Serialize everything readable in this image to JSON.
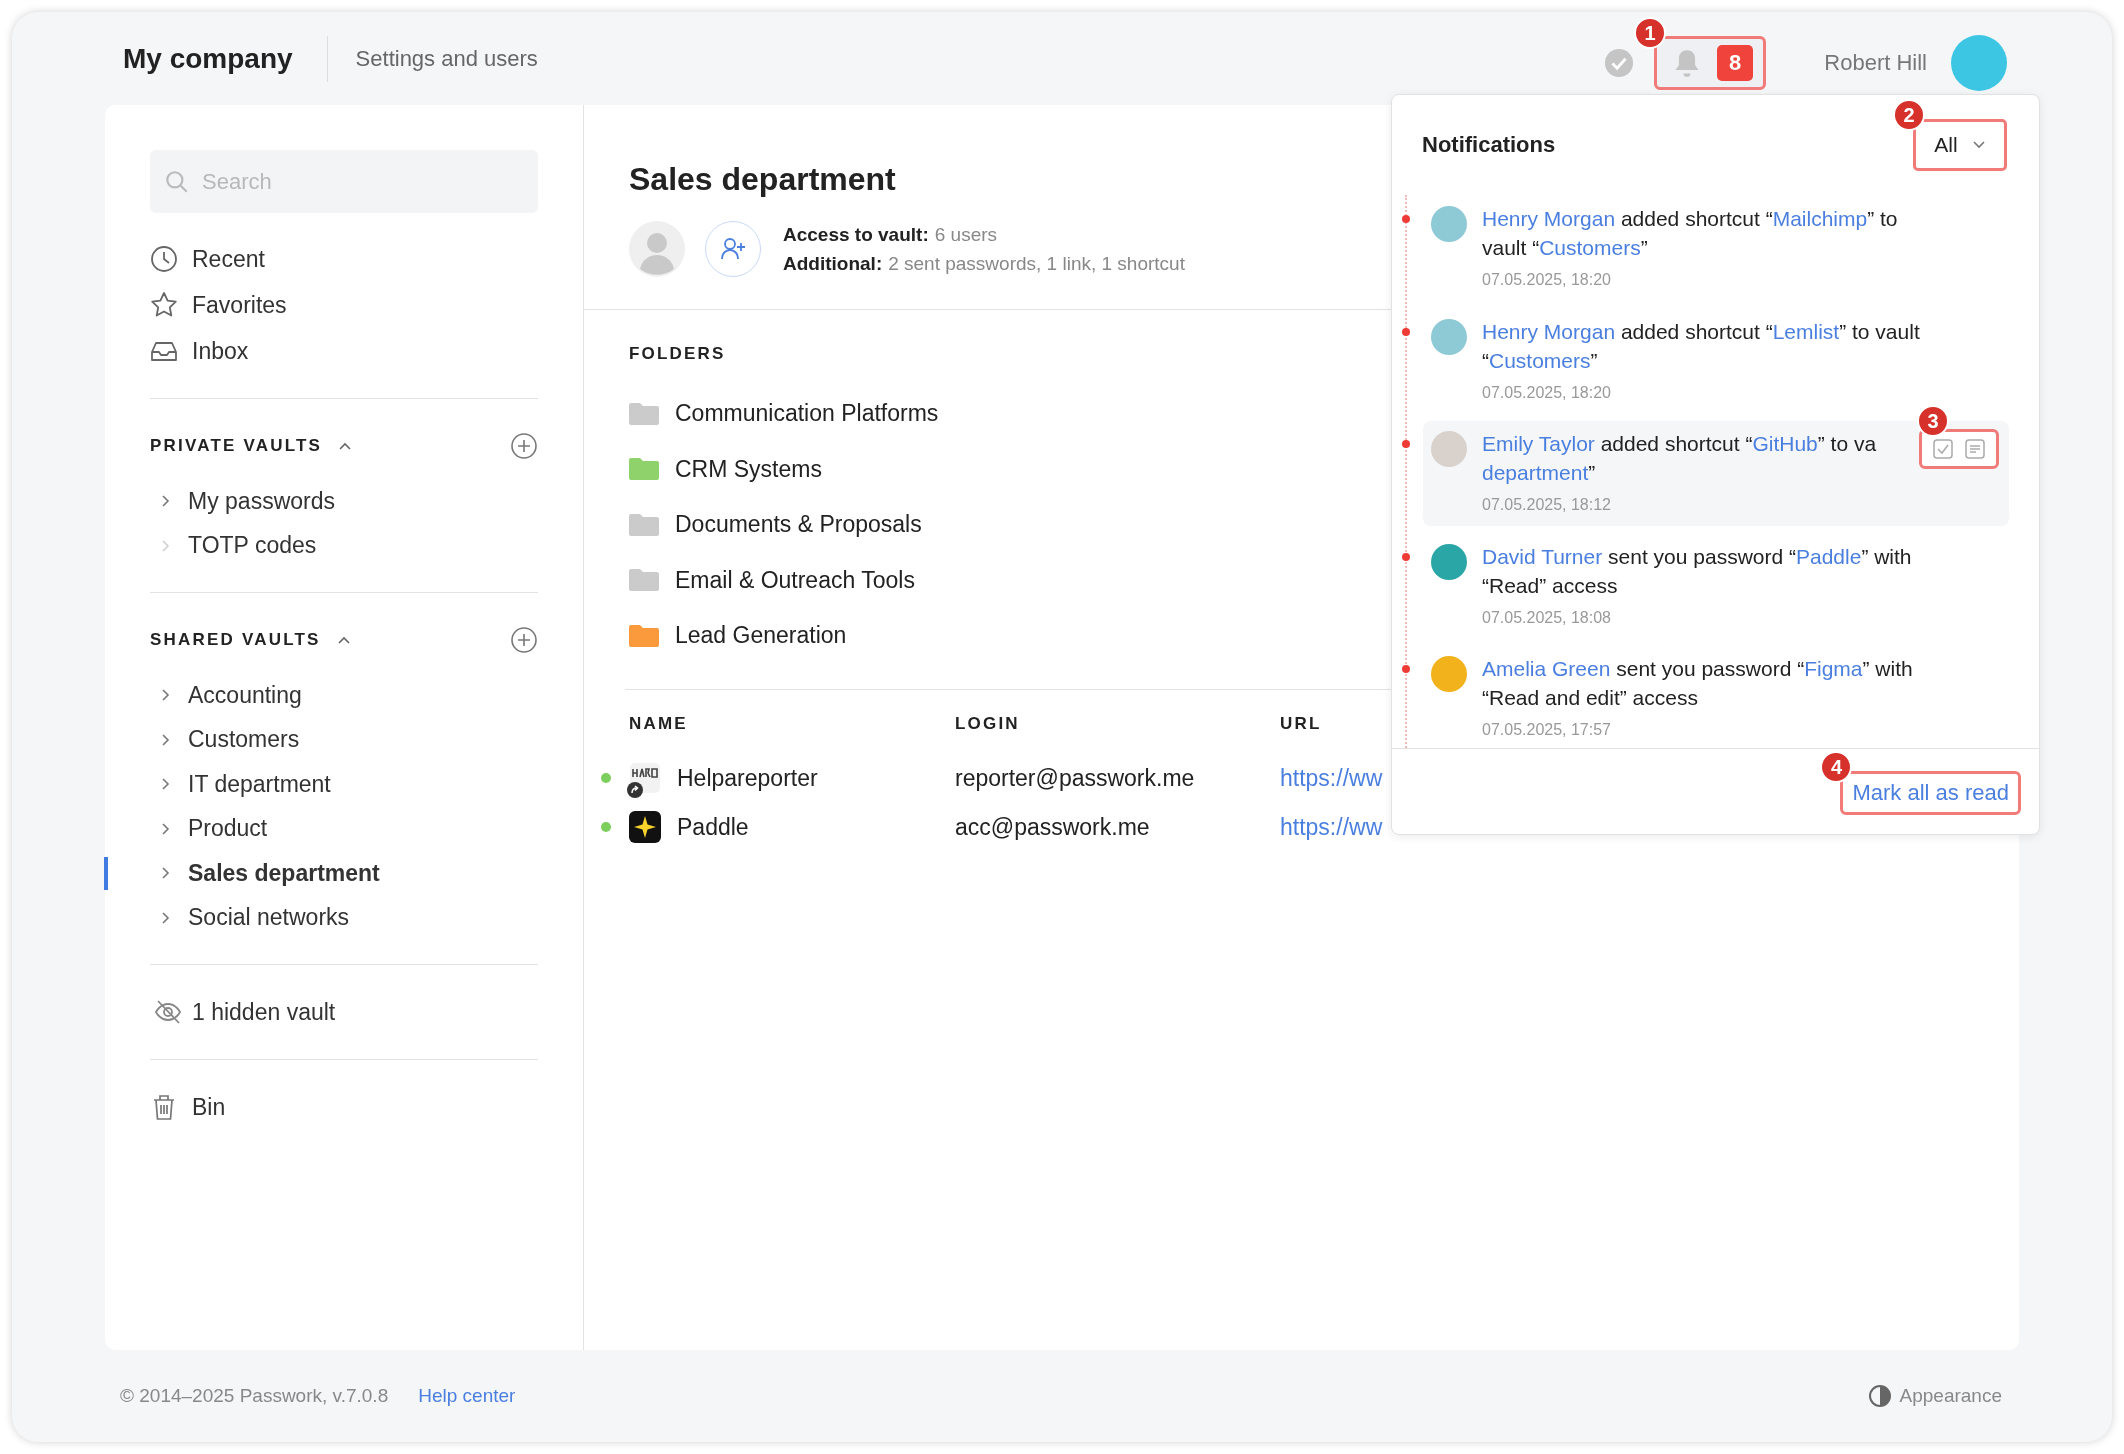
{
  "header": {
    "company": "My company",
    "section": "Settings and users",
    "notification_count": "8",
    "notification_callout": "1",
    "user_name": "Robert Hill"
  },
  "sidebar": {
    "search_placeholder": "Search",
    "nav": [
      {
        "label": "Recent"
      },
      {
        "label": "Favorites"
      },
      {
        "label": "Inbox"
      }
    ],
    "sections": [
      {
        "title": "PRIVATE VAULTS",
        "expanded": true,
        "items": [
          {
            "label": "My passwords",
            "has_children": true,
            "selected": false
          },
          {
            "label": "TOTP codes",
            "has_children": false,
            "selected": false
          }
        ]
      },
      {
        "title": "SHARED VAULTS",
        "expanded": true,
        "items": [
          {
            "label": "Accounting",
            "has_children": true,
            "selected": false
          },
          {
            "label": "Customers",
            "has_children": true,
            "selected": false
          },
          {
            "label": "IT department",
            "has_children": true,
            "selected": false
          },
          {
            "label": "Product",
            "has_children": true,
            "selected": false
          },
          {
            "label": "Sales department",
            "has_children": true,
            "selected": true
          },
          {
            "label": "Social networks",
            "has_children": true,
            "selected": false
          }
        ]
      }
    ],
    "hidden": "1 hidden vault",
    "bin": "Bin"
  },
  "vault": {
    "title": "Sales department",
    "info": [
      {
        "label": "Access to vault:",
        "value": "6 users"
      },
      {
        "label": "Additional:",
        "value": "2 sent passwords, 1 link, 1 shortcut"
      }
    ]
  },
  "folders": {
    "heading": "FOLDERS",
    "items": [
      {
        "name": "Communication Platforms",
        "color": "#cbcbcb"
      },
      {
        "name": "CRM Systems",
        "color": "#8fd16a"
      },
      {
        "name": "Documents & Proposals",
        "color": "#cbcbcb"
      },
      {
        "name": "Email & Outreach Tools",
        "color": "#cbcbcb"
      },
      {
        "name": "Lead Generation",
        "color": "#fb9a3c"
      }
    ]
  },
  "table": {
    "columns": [
      "NAME",
      "LOGIN",
      "URL"
    ],
    "rows": [
      {
        "name": "Helpareporter",
        "login": "reporter@passwork.me",
        "url": "https://ww",
        "active": true,
        "shortcut": true
      },
      {
        "name": "Paddle",
        "login": "acc@passwork.me",
        "url": "https://ww",
        "active": true,
        "shortcut": false
      }
    ]
  },
  "notifications": {
    "title": "Notifications",
    "filter": "All",
    "filter_callout": "2",
    "mark_all": "Mark all as read",
    "mark_all_callout": "4",
    "items": [
      {
        "unread": true,
        "highlighted": false,
        "color": "#8ec9d6",
        "time": "07.05.2025, 18:20",
        "lines": [
          [
            {
              "link": "Henry Morgan"
            },
            {
              "text": " added shortcut “"
            },
            {
              "link": "Mailchimp"
            },
            {
              "text": "” to"
            }
          ],
          [
            {
              "text": "vault “"
            },
            {
              "link": "Customers"
            },
            {
              "text": "”"
            }
          ]
        ]
      },
      {
        "unread": true,
        "highlighted": false,
        "color": "#8ec9d6",
        "time": "07.05.2025, 18:20",
        "lines": [
          [
            {
              "link": "Henry Morgan"
            },
            {
              "text": " added shortcut “"
            },
            {
              "link": "Lemlist"
            },
            {
              "text": "” to vault"
            }
          ],
          [
            {
              "text": "“"
            },
            {
              "link": "Customers"
            },
            {
              "text": "”"
            }
          ]
        ]
      },
      {
        "unread": true,
        "highlighted": true,
        "actions_callout": "3",
        "color": "#d9d2cc",
        "time": "07.05.2025, 18:12",
        "lines": [
          [
            {
              "link": "Emily Taylor"
            },
            {
              "text": " added shortcut “"
            },
            {
              "link": "GitHub"
            },
            {
              "text": "” to va"
            }
          ],
          [
            {
              "link": "department"
            },
            {
              "text": "”"
            }
          ]
        ]
      },
      {
        "unread": true,
        "highlighted": false,
        "color": "#2aa6a6",
        "time": "07.05.2025, 18:08",
        "lines": [
          [
            {
              "link": "David Turner"
            },
            {
              "text": " sent you password “"
            },
            {
              "link": "Paddle"
            },
            {
              "text": "” with"
            }
          ],
          [
            {
              "text": "“Read” access"
            }
          ]
        ]
      },
      {
        "unread": true,
        "highlighted": false,
        "color": "#f2b21b",
        "time": "07.05.2025, 17:57",
        "lines": [
          [
            {
              "link": "Amelia Green"
            },
            {
              "text": " sent you password “"
            },
            {
              "link": "Figma"
            },
            {
              "text": "” with"
            }
          ],
          [
            {
              "text": "“Read and edit” access"
            }
          ]
        ]
      }
    ]
  },
  "footer": {
    "copyright": "© 2014–2025 Passwork, v.7.0.8",
    "help": "Help center",
    "appearance": "Appearance"
  }
}
